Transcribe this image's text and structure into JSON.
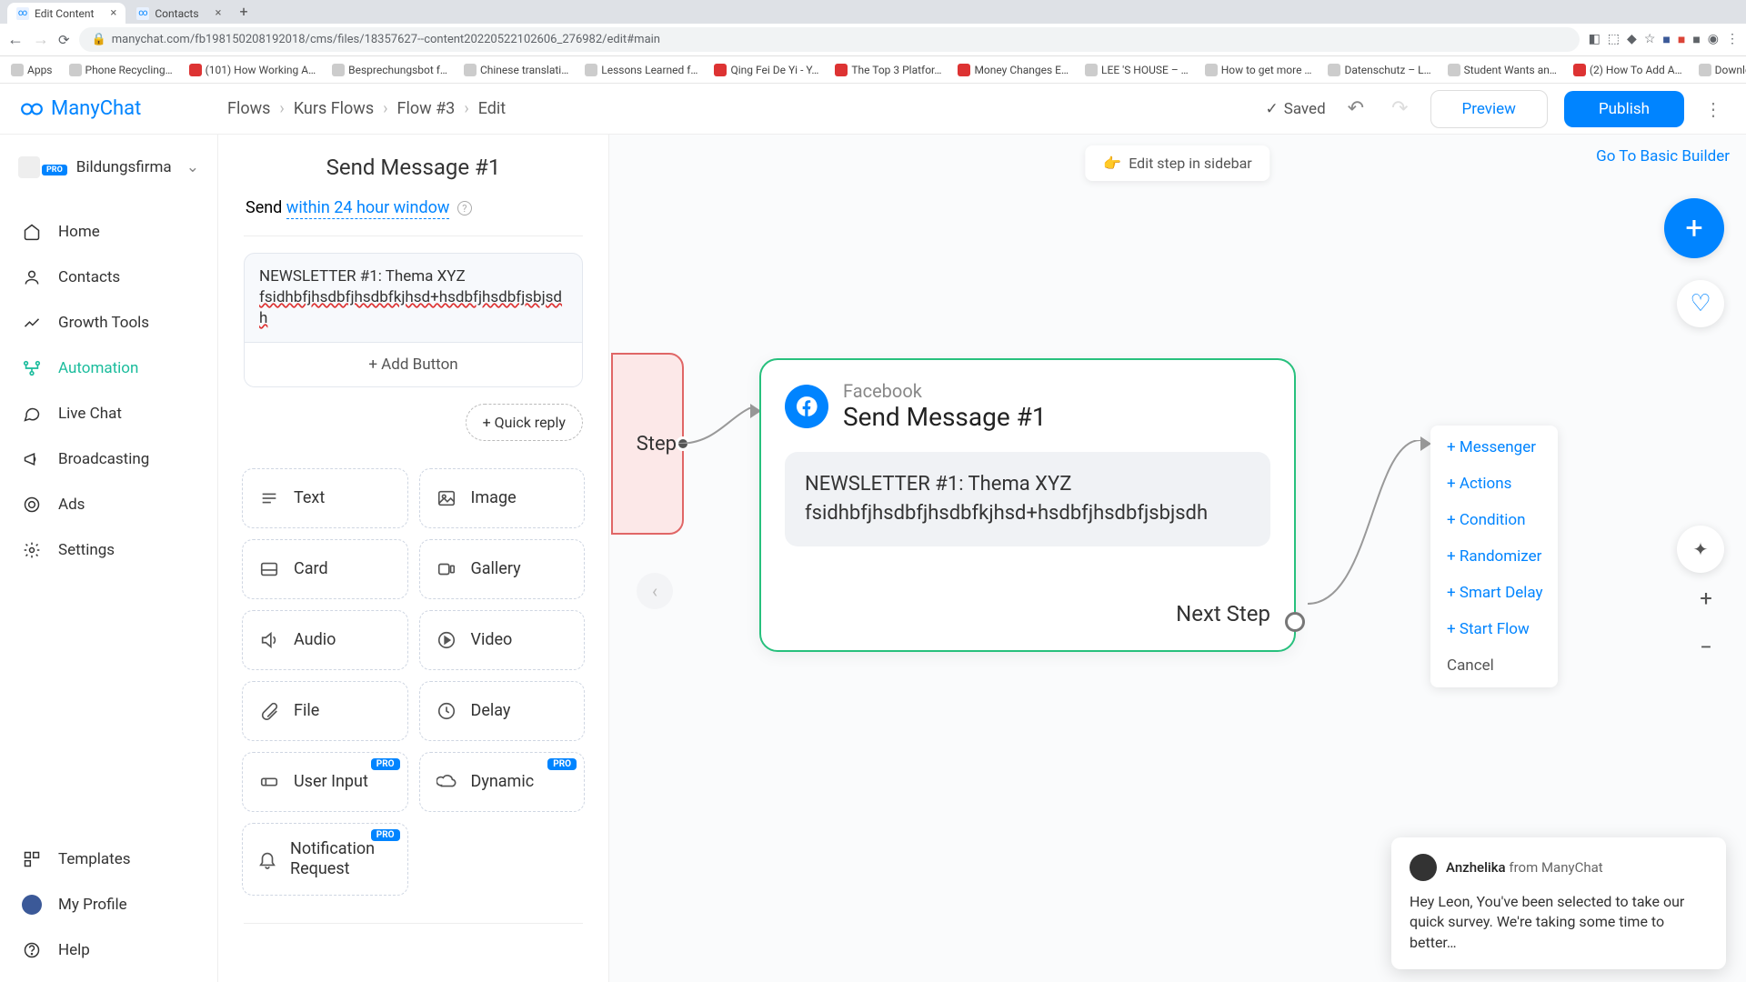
{
  "browser": {
    "tabs": [
      {
        "label": "Edit Content",
        "active": true
      },
      {
        "label": "Contacts",
        "active": false
      }
    ],
    "url": "manychat.com/fb198150208192018/cms/files/18357627--content20220522102606_276982/edit#main"
  },
  "bookmarks": [
    "Apps",
    "Phone Recycling…",
    "(101) How Working A…",
    "Besprechungsbot f…",
    "Chinese translati…",
    "Lessons Learned f…",
    "Qing Fei De Yi - Y…",
    "The Top 3 Platfor…",
    "Money Changes E…",
    "LEE 'S HOUSE – …",
    "How to get more …",
    "Datenschutz – L…",
    "Student Wants an…",
    "(2) How To Add A…",
    "Download - Cooki…"
  ],
  "header": {
    "app_name": "ManyChat",
    "breadcrumbs": [
      "Flows",
      "Kurs Flows",
      "Flow #3",
      "Edit"
    ],
    "saved_label": "Saved",
    "preview_label": "Preview",
    "publish_label": "Publish"
  },
  "sidebar": {
    "org_name": "Bildungsfirma",
    "pro": "PRO",
    "nav": [
      {
        "label": "Home",
        "icon": "home"
      },
      {
        "label": "Contacts",
        "icon": "user"
      },
      {
        "label": "Growth Tools",
        "icon": "chart"
      },
      {
        "label": "Automation",
        "icon": "flow",
        "active": true
      },
      {
        "label": "Live Chat",
        "icon": "chat"
      },
      {
        "label": "Broadcasting",
        "icon": "megaphone"
      },
      {
        "label": "Ads",
        "icon": "target"
      }
    ],
    "settings_label": "Settings",
    "bottom": [
      {
        "label": "Templates"
      },
      {
        "label": "My Profile"
      },
      {
        "label": "Help"
      }
    ]
  },
  "editor": {
    "title": "Send Message #1",
    "send_prefix": "Send ",
    "send_link": "within 24 hour window",
    "message_line1": "NEWSLETTER #1: Thema XYZ",
    "message_line2": "fsidhbfjhsdbfjhsdbfkjhsd+hsdbfjhsdbfjsbjsdh",
    "add_button": "+ Add Button",
    "quick_reply": "+ Quick reply",
    "blocks": [
      {
        "label": "Text",
        "icon": "text"
      },
      {
        "label": "Image",
        "icon": "image"
      },
      {
        "label": "Card",
        "icon": "card"
      },
      {
        "label": "Gallery",
        "icon": "gallery"
      },
      {
        "label": "Audio",
        "icon": "audio"
      },
      {
        "label": "Video",
        "icon": "video"
      },
      {
        "label": "File",
        "icon": "file"
      },
      {
        "label": "Delay",
        "icon": "delay"
      },
      {
        "label": "User Input",
        "icon": "input",
        "pro": true
      },
      {
        "label": "Dynamic",
        "icon": "dynamic",
        "pro": true
      },
      {
        "label": "Notification Request",
        "icon": "bell",
        "pro": true,
        "wide": true
      }
    ]
  },
  "canvas": {
    "edit_sidebar_label": "Edit step in sidebar",
    "basic_builder_label": "Go To Basic Builder",
    "peek_step_label": "Step",
    "node": {
      "kicker": "Facebook",
      "title": "Send Message #1",
      "body_line1": "NEWSLETTER #1: Thema XYZ",
      "body_line2": "fsidhbfjhsdbfjhsdbfkjhsd+hsdbfjhsdbfjsbjsdh",
      "next_step": "Next Step"
    },
    "context_menu": [
      "+ Messenger",
      "+ Actions",
      "+ Condition",
      "+ Randomizer",
      "+ Smart Delay",
      "+ Start Flow",
      "Cancel"
    ]
  },
  "chat": {
    "user": "Anzhelika",
    "from": " from ManyChat",
    "body": "Hey Leon,  You've been selected to take our quick survey. We're taking some time to better…"
  }
}
